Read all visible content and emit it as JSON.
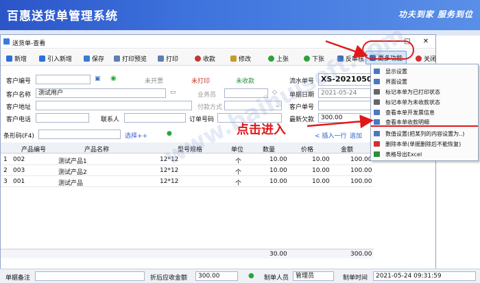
{
  "banner": {
    "title": "百惠送货单管理系统",
    "slogan": "功夫到家 服务到位"
  },
  "window": {
    "title": "送货单-查看"
  },
  "toolbar": [
    {
      "label": "新增",
      "color": "#2f6fd6",
      "icon": "new-icon"
    },
    {
      "label": "引入新增",
      "color": "#2f6fd6",
      "icon": "import-icon"
    },
    {
      "label": "保存",
      "color": "#3a7bd5",
      "icon": "save-icon"
    },
    {
      "label": "打印预览",
      "color": "#5b7fb8",
      "icon": "print-preview-icon"
    },
    {
      "label": "打印",
      "color": "#5b7fb8",
      "icon": "print-icon"
    },
    {
      "label": "收款",
      "color": "#c0392b",
      "icon": "payment-icon"
    },
    {
      "label": "修改",
      "color": "#c79a2a",
      "icon": "edit-icon"
    },
    {
      "label": "上张",
      "color": "#2aa43a",
      "icon": "prev-icon"
    },
    {
      "label": "下张",
      "color": "#2aa43a",
      "icon": "next-icon"
    },
    {
      "label": "反审核",
      "color": "#3a6fc0",
      "icon": "unaudit-icon"
    },
    {
      "label": "更多功能",
      "color": "#3a6fc0",
      "icon": "more-icon"
    },
    {
      "label": "关闭",
      "color": "#d03030",
      "icon": "close-icon"
    }
  ],
  "form": {
    "customer_code_label": "客户编号",
    "customer_name_label": "客户名称",
    "customer_name": "测试用户",
    "customer_address_label": "客户地址",
    "customer_phone_label": "客户电话",
    "contact_label": "联系人",
    "order_no_label": "订单号码",
    "status_unissued": "未开票",
    "status_unprinted": "未打印",
    "status_unpaid": "未收款",
    "salesman_label": "业务员",
    "payment_method_label": "付款方式",
    "doc_no_label": "流水单号",
    "doc_no": "XS-20210500",
    "doc_date_label": "单据日期",
    "doc_date": "2021-05-24",
    "customer_doc_label": "客户单号",
    "latest_debt_label": "最新欠款",
    "latest_debt": "300.00",
    "barcode_label": "条形码(F4)",
    "select_link": "选择++",
    "insert_row": "< 插入一行",
    "add_row": "追加"
  },
  "grid": {
    "columns": [
      "产品编号",
      "产品名称",
      "型号规格",
      "单位",
      "数量",
      "价格",
      "金额"
    ],
    "rows": [
      {
        "idx": "1",
        "code": "002",
        "name": "测试产品1",
        "spec": "12*12",
        "unit": "个",
        "qty": "10.00",
        "price": "10.00",
        "amount": "100.00"
      },
      {
        "idx": "2",
        "code": "003",
        "name": "测试产品2",
        "spec": "12*12",
        "unit": "个",
        "qty": "10.00",
        "price": "10.00",
        "amount": "100.00"
      },
      {
        "idx": "3",
        "code": "001",
        "name": "测试产品",
        "spec": "12*12",
        "unit": "个",
        "qty": "10.00",
        "price": "10.00",
        "amount": "100.00"
      }
    ],
    "total_qty": "30.00",
    "total_amount": "300.00"
  },
  "bottom": {
    "remark_label": "单据备注",
    "discount_label": "折后应收金额",
    "discount_value": "300.00",
    "maker_label": "制单人员",
    "maker_value": "管理员",
    "time_label": "制单时间",
    "time_value": "2021-05-24 09:31:59"
  },
  "menu": [
    "显示设置",
    "界面设置",
    "标记本单为已打印状态",
    "标记本单为未收款状态",
    "查看本单开发票信息",
    "查看本单收款明细",
    "数值设置(把某列的内容设置为..)",
    "删除本单(单据删除后不能恢复)",
    "表格导出Excel"
  ],
  "annotation": "点击进入",
  "watermark": "www.baihuisoft.com",
  "colors": {
    "accent": "#2f5fcf",
    "annotation": "#e01818",
    "status_red": "#c0392b",
    "status_green": "#2a8f3a"
  }
}
